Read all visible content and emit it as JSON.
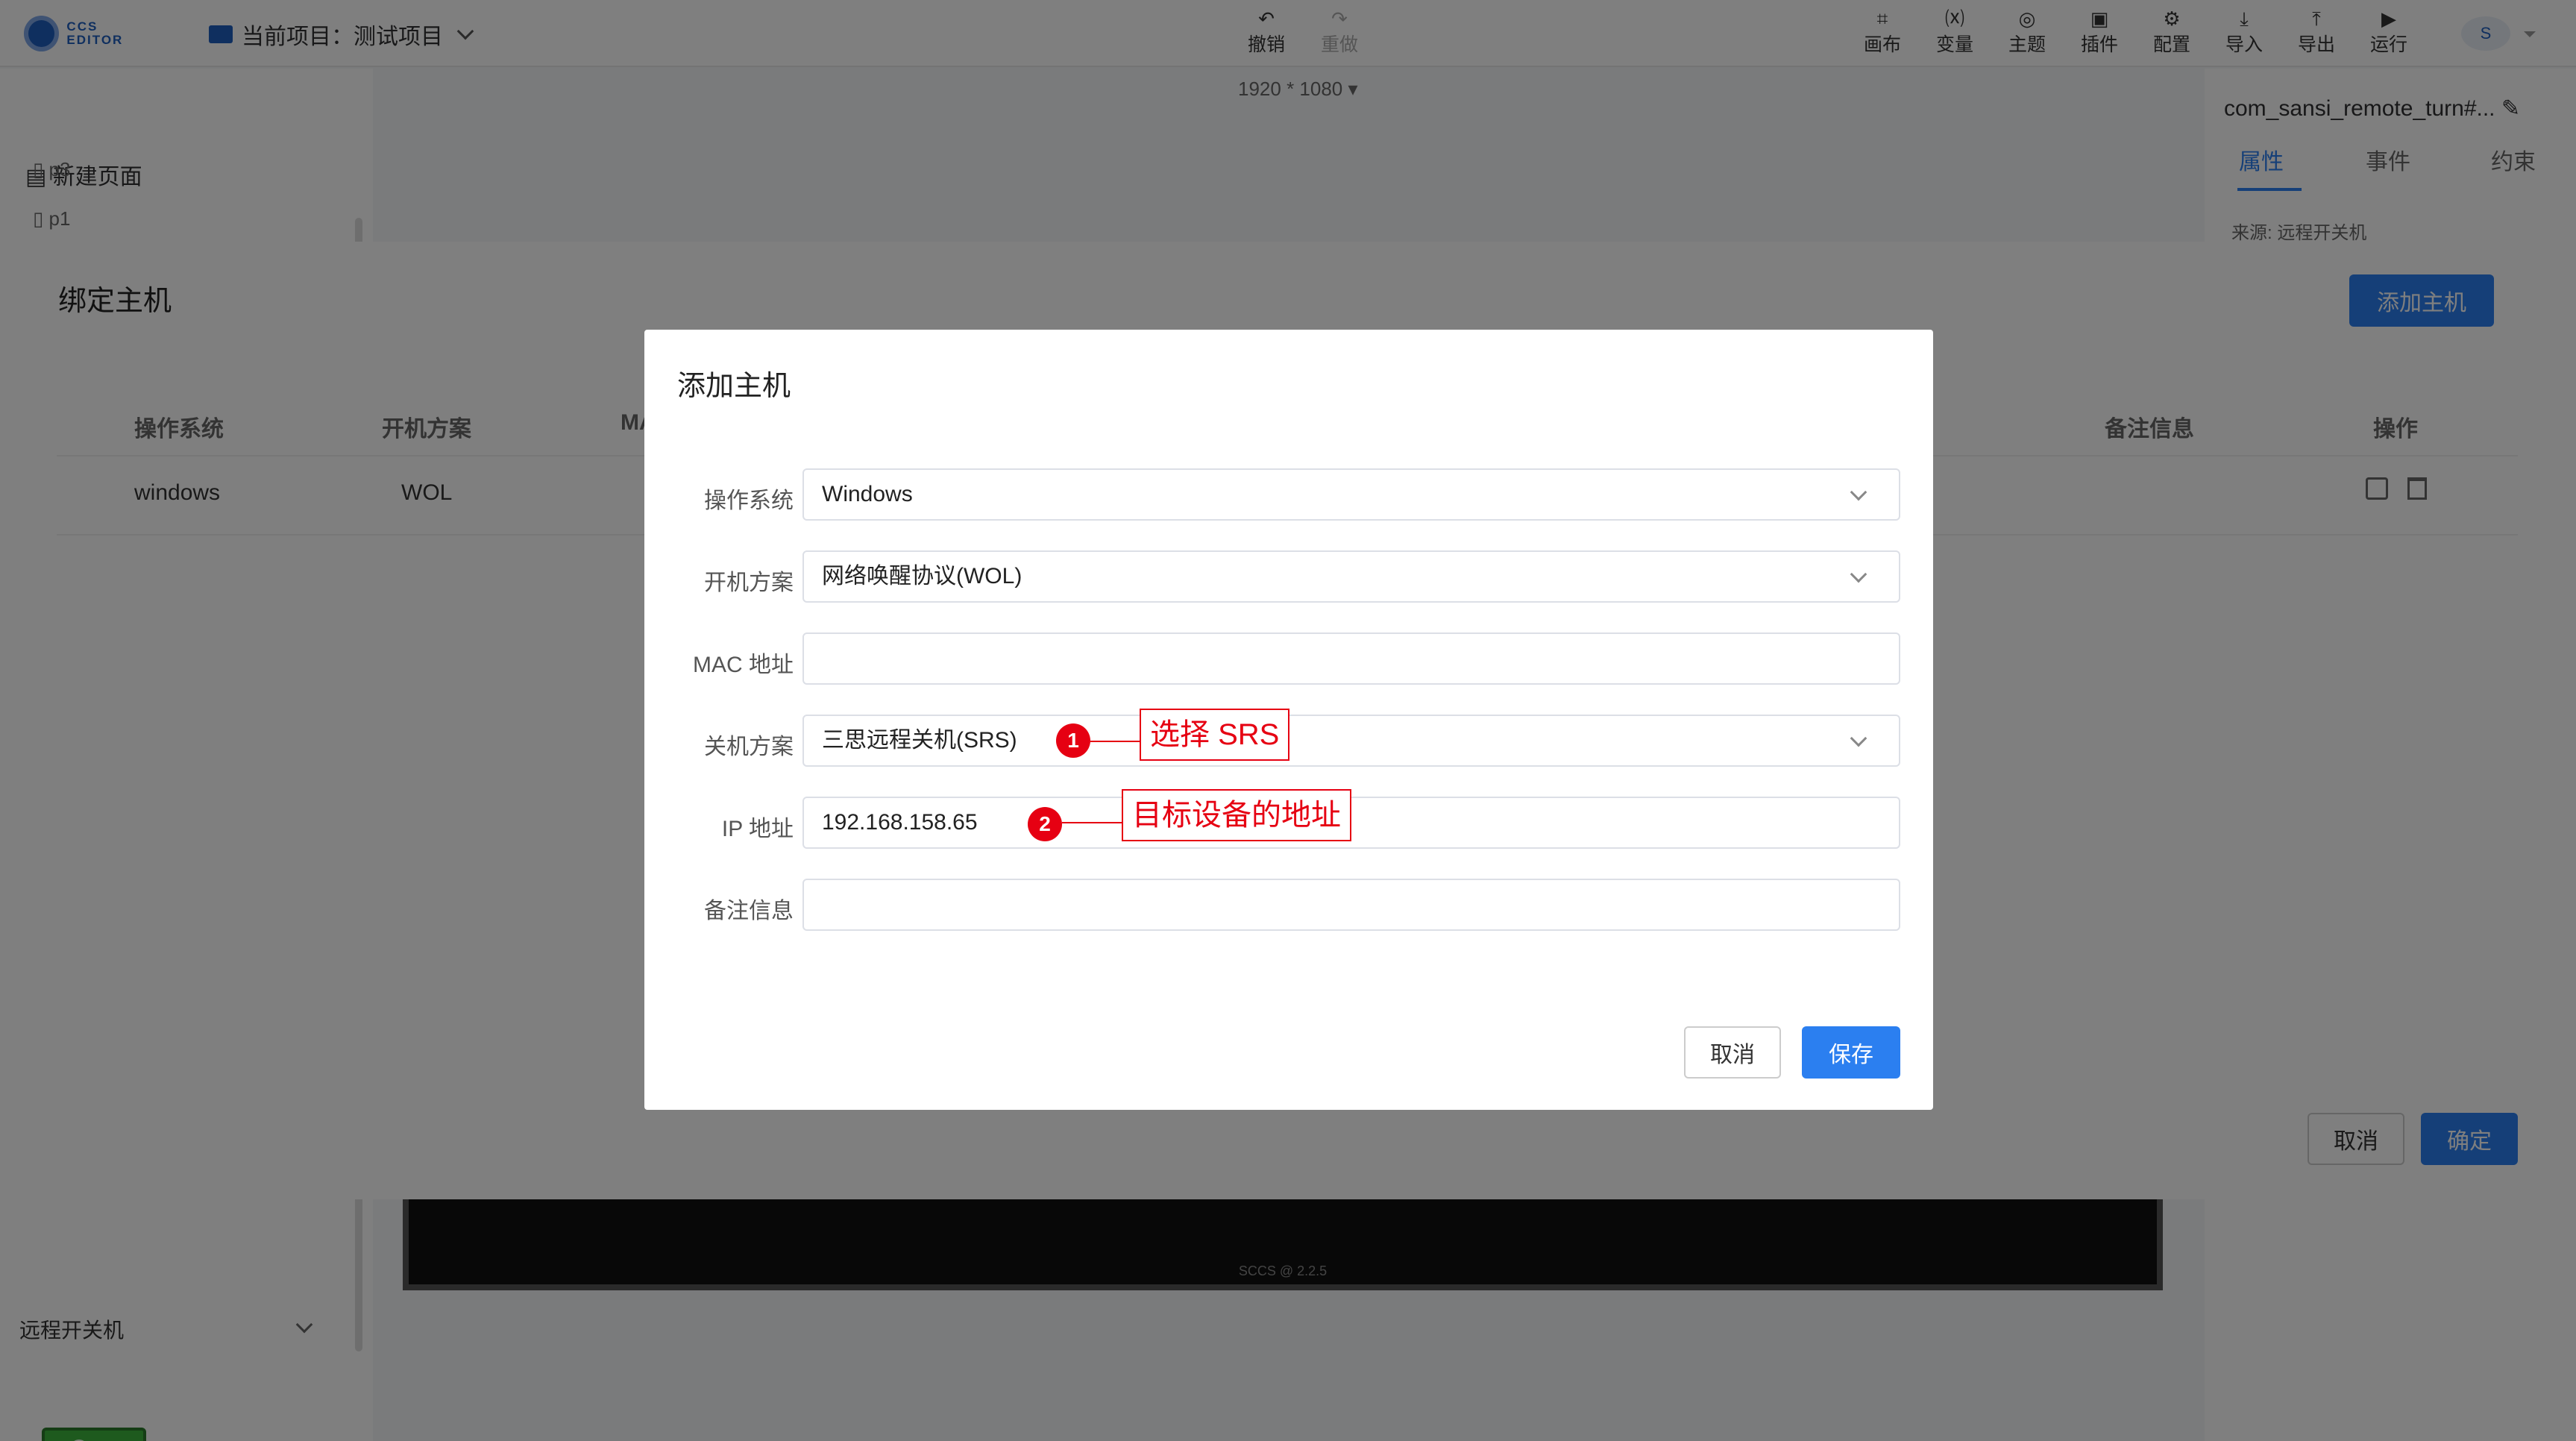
{
  "app": {
    "logo_text": "CCS EDITOR",
    "project_label": "当前项目：测试项目"
  },
  "toolbar": {
    "undo": "撤销",
    "redo": "重做",
    "canvas": "画布",
    "variable": "变量",
    "theme": "主题",
    "plugin": "插件",
    "config": "配置",
    "import": "导入",
    "export": "导出",
    "run": "运行",
    "avatar": "S"
  },
  "resolution": "1920 * 1080",
  "left_panel": {
    "new_page": "新建页面",
    "pages": [
      "p3",
      "p1"
    ],
    "remote_group": "远程开关机",
    "switch_label": "开"
  },
  "canvas_footer": "SCCS @ 2.2.5",
  "right_panel": {
    "component_title": "com_sansi_remote_turn#...",
    "tabs": [
      "属性",
      "事件",
      "约束"
    ],
    "source": "来源: 远程开关机"
  },
  "bind_dialog": {
    "title": "绑定主机",
    "add_button": "添加主机",
    "columns": {
      "os": "操作系统",
      "boot": "开机方案",
      "mac": "MA",
      "remark": "备注信息",
      "action": "操作"
    },
    "rows": [
      {
        "os": "windows",
        "boot": "WOL"
      }
    ],
    "cancel": "取消",
    "confirm": "确定"
  },
  "host_dialog": {
    "title": "添加主机",
    "fields": {
      "os": {
        "label": "操作系统",
        "value": "Windows"
      },
      "boot": {
        "label": "开机方案",
        "value": "网络唤醒协议(WOL)"
      },
      "mac": {
        "label": "MAC 地址",
        "value": ""
      },
      "shutdown": {
        "label": "关机方案",
        "value": "三思远程关机(SRS)"
      },
      "ip": {
        "label": "IP 地址",
        "value": "192.168.158.65"
      },
      "remark": {
        "label": "备注信息",
        "value": ""
      }
    },
    "cancel": "取消",
    "save": "保存"
  },
  "annotations": [
    {
      "number": "1",
      "text": "选择 SRS"
    },
    {
      "number": "2",
      "text": "目标设备的地址"
    }
  ]
}
